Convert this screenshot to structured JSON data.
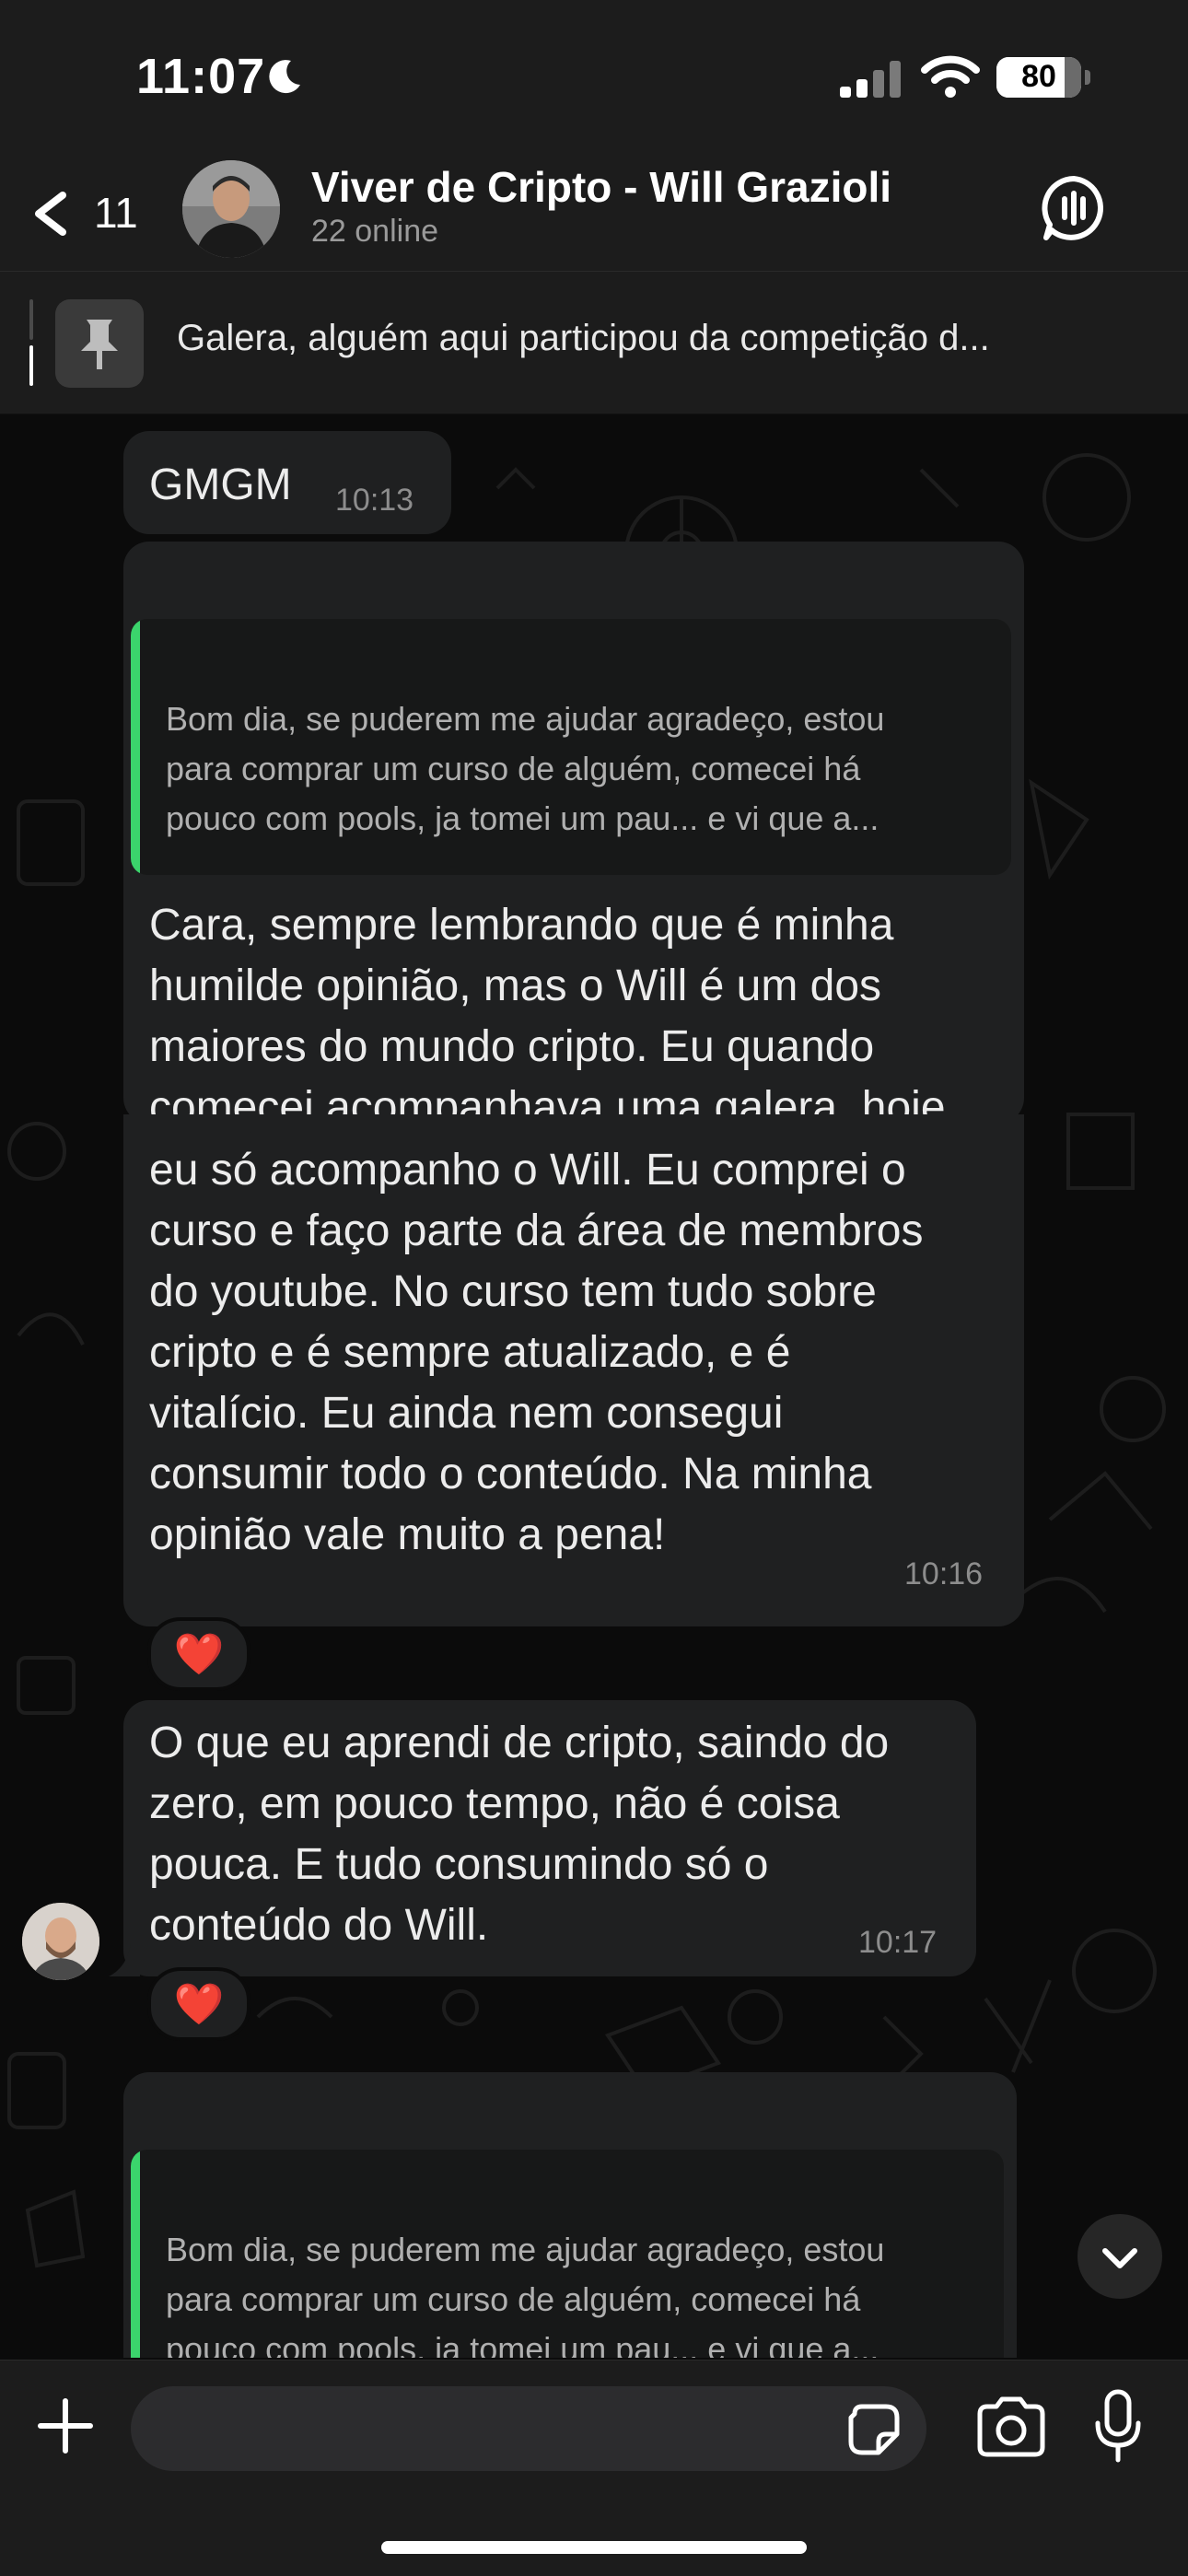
{
  "status_bar": {
    "time": "11:07",
    "battery": "80",
    "battery_level": 0.8
  },
  "header": {
    "back_count": "11",
    "title": "Viver de Cripto - Will Grazioli",
    "subtitle": "22 online"
  },
  "pinned": {
    "text": "Galera, alguém aqui participou da competição d..."
  },
  "messages": [
    {
      "text": "GMGM",
      "time": "10:13"
    },
    {
      "quote_lines": [
        "Bom dia, se puderem me ajudar agradeço, estou",
        "para comprar um curso de alguém, comecei há",
        "pouco com pools, ja tomei um pau... e vi que a..."
      ],
      "lines": [
        "Cara, sempre lembrando que é minha",
        "humilde opinião, mas o Will é um dos",
        "maiores do mundo cripto. Eu quando",
        "comecei acompanhava uma galera, hoje",
        "eu só acompanho o Will. Eu comprei o",
        "curso e faço parte da área de membros",
        "do youtube. No curso tem tudo sobre",
        "cripto e é sempre atualizado, e é",
        "vitalício. Eu ainda nem consegui",
        "consumir todo o conteúdo. Na minha",
        "opinião vale muito a pena!"
      ],
      "time": "10:16",
      "reaction": "❤️"
    },
    {
      "lines": [
        "O que eu aprendi de cripto, saindo do",
        "zero, em pouco tempo, não é coisa",
        "pouca. E tudo consumindo só o",
        "conteúdo do Will."
      ],
      "time": "10:17",
      "reaction": "❤️"
    },
    {
      "quote_lines": [
        "Bom dia, se puderem me ajudar agradeço, estou",
        "para comprar um curso de alguém, comecei há",
        "pouco com pools, ja tomei um pau... e vi que a..."
      ]
    }
  ],
  "composer": {
    "placeholder": ""
  },
  "colors": {
    "quote_accent": "#3bd46c",
    "bubble": "#1f2021",
    "background": "#0b0b0b"
  },
  "icons": [
    "moon-icon",
    "signal-icon",
    "wifi-icon",
    "back-chevron-icon",
    "voice-chat-icon",
    "pin-icon",
    "chevron-down-icon",
    "plus-icon",
    "sticker-icon",
    "camera-icon",
    "microphone-icon"
  ]
}
